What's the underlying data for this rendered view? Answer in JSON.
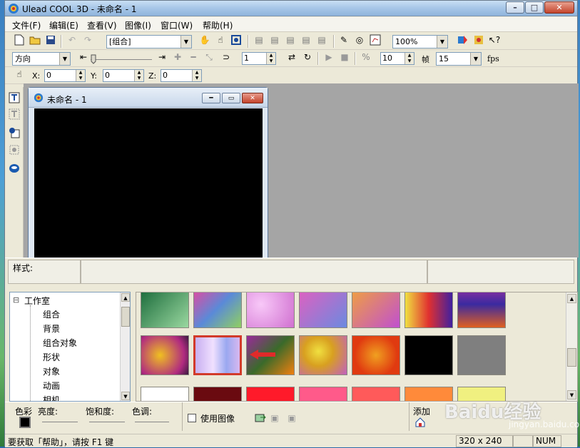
{
  "window": {
    "title": "Ulead COOL 3D - 未命名 - 1",
    "min": "–",
    "max": "□",
    "close": "✕"
  },
  "menu": [
    "文件(F)",
    "编辑(E)",
    "查看(V)",
    "图像(I)",
    "窗口(W)",
    "帮助(H)"
  ],
  "toolbar1": {
    "object_combo": "[组合]",
    "zoom_combo": "100%"
  },
  "toolbar2": {
    "direction_combo": "方向",
    "step_value": "1",
    "frames_value": "10",
    "frames_label": "帧",
    "fps_combo": "15",
    "fps_label": "fps"
  },
  "toolbar3": {
    "x_label": "X:",
    "x_value": "0",
    "y_label": "Y:",
    "y_value": "0",
    "z_label": "Z:",
    "z_value": "0"
  },
  "doc": {
    "title": "未命名 - 1"
  },
  "style": {
    "label": "样式:"
  },
  "tree": {
    "root": "工作室",
    "items": [
      "组合",
      "背景",
      "组合对象",
      "形状",
      "对象",
      "动画",
      "相机"
    ]
  },
  "thumbnails": {
    "row1": [
      "#2f8a4c",
      "#c05aa0",
      "#d88be0",
      "#a56be0",
      "#e5a060",
      "#e53a3a",
      "#6e3ab0"
    ],
    "row2": [
      "#d8a020",
      "#b9a6ef",
      "#8a2a80",
      "#e0c040",
      "#e06020",
      "#000000",
      "#7f7f7f"
    ],
    "row3": [
      "#ffffff",
      "#6a0a10",
      "#ff1a2a",
      "#ff5a8a",
      "#ff5a5a",
      "#ff8a3a",
      "#f0f080"
    ],
    "selected_color": "#d23a2a"
  },
  "colorbar": {
    "color_label": "色彩",
    "brightness_label": "亮度:",
    "saturation_label": "饱和度:",
    "hue_label": "色调:",
    "use_image_label": "使用图像",
    "add_label": "添加"
  },
  "status": {
    "help": "要获取「帮助」，请按 F1 键",
    "size": "320 x 240",
    "num": "NUM"
  },
  "watermark": {
    "logo": "Baidu经验",
    "url": "jingyan.baidu.com"
  },
  "colors": {
    "accent": "#3a6ea5",
    "canvas": "#000000",
    "workspace": "#a5a5a5"
  }
}
